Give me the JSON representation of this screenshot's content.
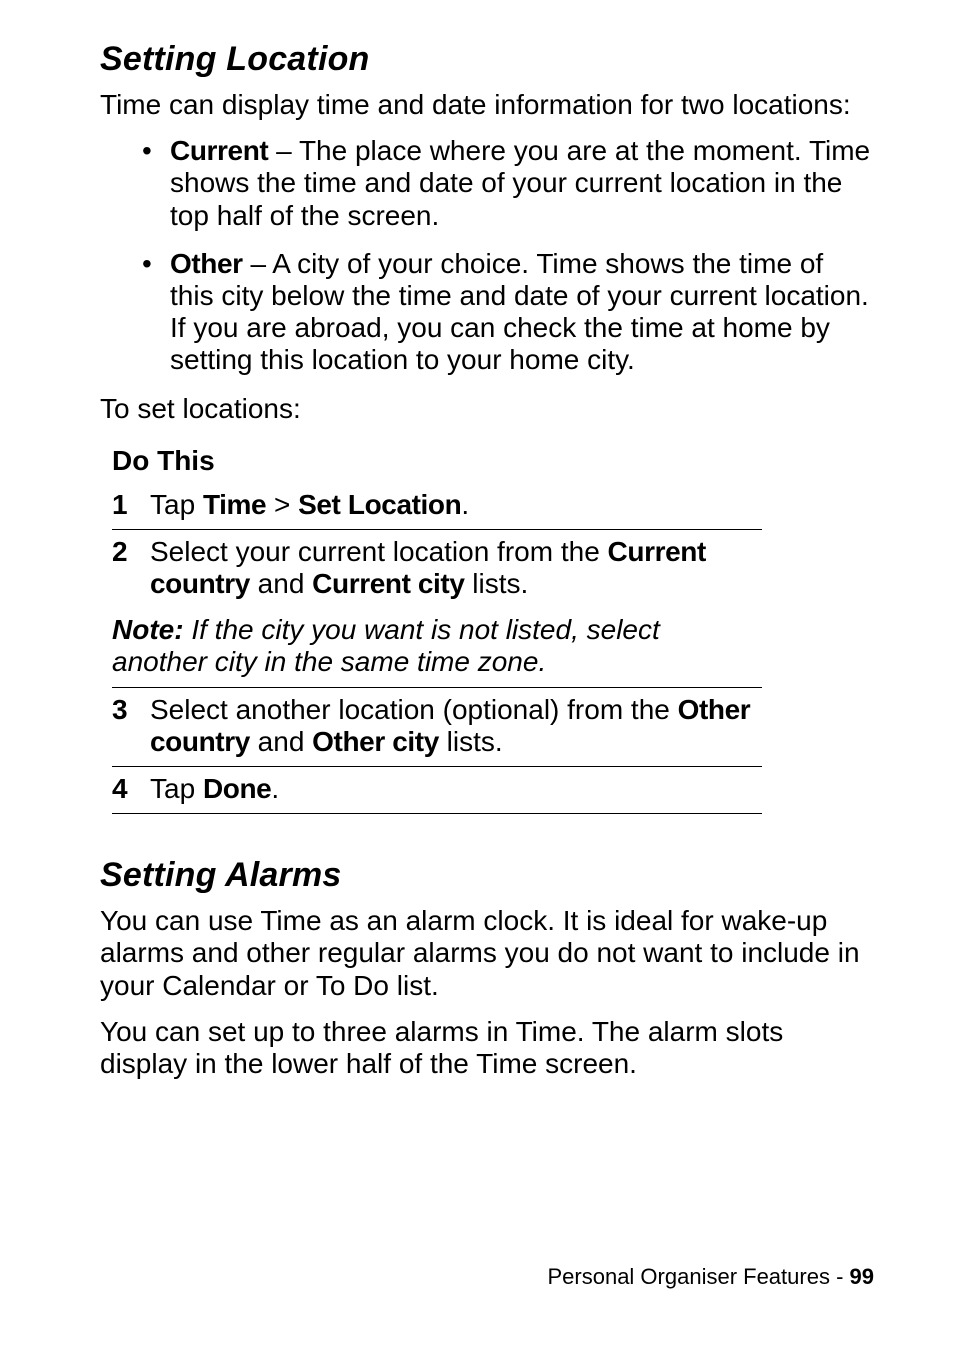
{
  "section1": {
    "heading": "Setting Location",
    "intro": "Time can display time and date information for two locations:",
    "bullets": [
      {
        "label": "Current",
        "text": " – The place where you are at the moment. Time shows the time and date of your current location in the top half of the screen."
      },
      {
        "label": "Other",
        "text": " – A city of your choice. Time shows the time of this city below the time and date of your current location. If you are abroad, you can check the time at home by setting this location to your home city."
      }
    ],
    "to_set": "To set locations:",
    "do_this": "Do This",
    "steps": {
      "s1": {
        "n": "1",
        "pre": "Tap ",
        "b1": "Time",
        "mid": " > ",
        "b2": "Set Location",
        "post": "."
      },
      "s2": {
        "n": "2",
        "pre": "Select your current location from the ",
        "b1": "Current country",
        "mid": " and ",
        "b2": "Current city",
        "post": " lists."
      },
      "s3": {
        "n": "3",
        "pre": "Select another location (optional) from the ",
        "b1": "Other country",
        "mid": " and ",
        "b2": "Other city",
        "post": " lists."
      },
      "s4": {
        "n": "4",
        "pre": "Tap ",
        "b1": "Done",
        "post": "."
      }
    },
    "note_label": "Note:",
    "note_text": " If the city you want is not listed, select another city in the same time zone."
  },
  "section2": {
    "heading": "Setting Alarms",
    "p1": "You can use Time as an alarm clock. It is ideal for wake-up alarms and other regular alarms you do not want to include in your Calendar or To Do list.",
    "p2": "You can set up to three alarms in Time. The alarm slots display in the lower half of the Time screen."
  },
  "footer": {
    "chapter": "Personal Organiser Features - ",
    "page": "99"
  }
}
